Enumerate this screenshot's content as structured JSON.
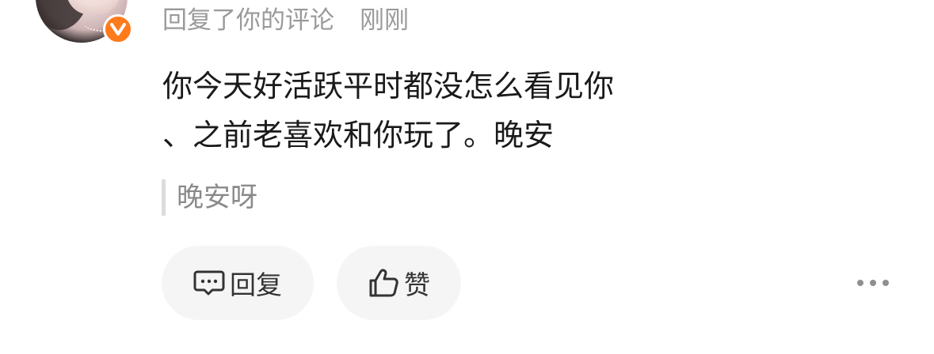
{
  "comment": {
    "action_text": "回复了你的评论",
    "time_text": "刚刚",
    "lines": [
      "你今天好活跃平时都没怎么看见你",
      "、之前老喜欢和你玩了。晚安"
    ],
    "quoted_text": "晚安呀"
  },
  "actions": {
    "reply_label": "回复",
    "like_label": "赞"
  },
  "icons": {
    "verified_badge": "v-badge-icon",
    "reply": "comment-bubble-icon",
    "like": "thumbs-up-icon",
    "more": "more-dots-icon"
  },
  "colors": {
    "badge": "#ff7a1a",
    "meta_text": "#9a9a9a",
    "body_text": "#1a1a1a",
    "button_bg": "#f5f5f5"
  }
}
